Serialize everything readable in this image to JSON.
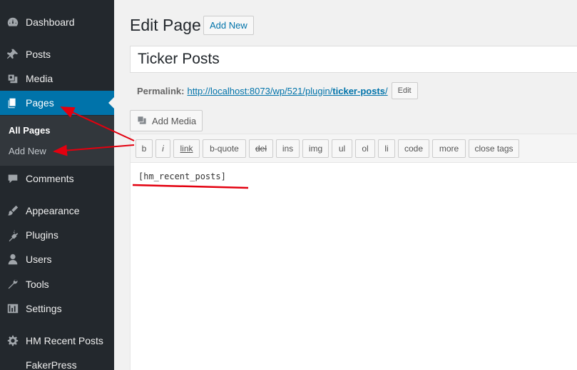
{
  "sidebar": {
    "items": [
      {
        "label": "Dashboard",
        "icon": "dashboard-icon"
      },
      {
        "label": "Posts",
        "icon": "pin-icon"
      },
      {
        "label": "Media",
        "icon": "media-icon"
      },
      {
        "label": "Pages",
        "icon": "pages-icon",
        "active": true
      },
      {
        "label": "Comments",
        "icon": "comment-icon"
      },
      {
        "label": "Appearance",
        "icon": "brush-icon"
      },
      {
        "label": "Plugins",
        "icon": "plug-icon"
      },
      {
        "label": "Users",
        "icon": "user-icon"
      },
      {
        "label": "Tools",
        "icon": "wrench-icon"
      },
      {
        "label": "Settings",
        "icon": "settings-icon"
      },
      {
        "label": "HM Recent Posts",
        "icon": "gear-icon"
      },
      {
        "label": "FakerPress",
        "icon": ""
      }
    ],
    "submenu": {
      "all_pages": "All Pages",
      "add_new": "Add New"
    },
    "active_color": "#0073aa"
  },
  "main": {
    "title": "Edit Page",
    "add_new": "Add New",
    "post_title": "Ticker Posts",
    "permalink_label": "Permalink:",
    "permalink_base": "http://localhost:8073/wp/521/plugin/",
    "permalink_slug": "ticker-posts",
    "permalink_trailing": "/",
    "edit_button": "Edit",
    "add_media": "Add Media",
    "toolbar": [
      "b",
      "i",
      "link",
      "b-quote",
      "del",
      "ins",
      "img",
      "ul",
      "ol",
      "li",
      "code",
      "more",
      "close tags"
    ],
    "content": "[hm_recent_posts]"
  },
  "annotation_color": "#e3000f"
}
